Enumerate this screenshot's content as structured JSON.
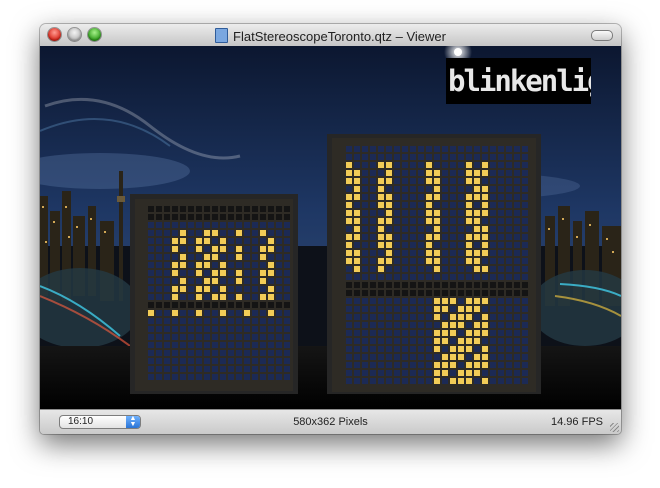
{
  "window": {
    "title": "FlatStereoscopeToronto.qtz – Viewer",
    "document_icon": "qtz-document-icon"
  },
  "viewer": {
    "logo_text": "blinkenligh"
  },
  "statusbar": {
    "aspect_ratio": "16:10",
    "dimensions": "580x362 Pixels",
    "fps": "14.96 FPS"
  },
  "colors": {
    "sky": "#14233f",
    "window_lit": "#f2cc57",
    "window_dark": "#1c2a55",
    "building": "#262626"
  }
}
